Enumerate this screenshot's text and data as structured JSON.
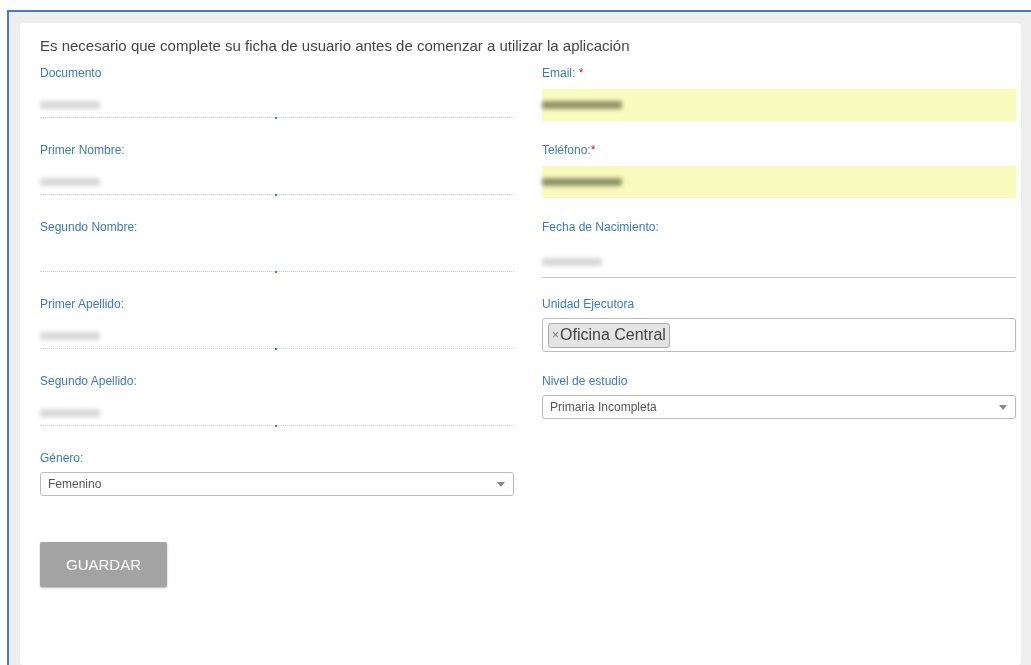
{
  "heading": "Es necesario que complete su ficha de usuario antes de comenzar a utilizar la aplicación",
  "left_fields": [
    {
      "label": "Documento",
      "kind": "dotted",
      "redacted": true
    },
    {
      "label": "Primer Nombre:",
      "kind": "dotted",
      "redacted": true
    },
    {
      "label": "Segundo Nombre:",
      "kind": "dotted",
      "redacted": false
    },
    {
      "label": "Primer Apellido:",
      "kind": "dotted",
      "redacted": true
    },
    {
      "label": "Segundo Apellido:",
      "kind": "dotted",
      "redacted": true
    },
    {
      "label": "Género:",
      "kind": "select",
      "value": "Femenino"
    }
  ],
  "right_fields": [
    {
      "label": "Email:",
      "kind": "highlight",
      "required_mark": " *",
      "redacted": true
    },
    {
      "label": "Teléfono:",
      "kind": "highlight",
      "required_mark": "*",
      "redacted": true
    },
    {
      "label": "Fecha de Nacimiento:",
      "kind": "underline",
      "redacted": true
    },
    {
      "label": "Unidad Ejecutora",
      "kind": "tags",
      "tags": [
        {
          "remove": "×",
          "text": "Oficina Central"
        }
      ]
    },
    {
      "label": "Nivel de estudio",
      "kind": "select",
      "value": "Primaria Incompleta"
    }
  ],
  "save_button": "GUARDAR"
}
